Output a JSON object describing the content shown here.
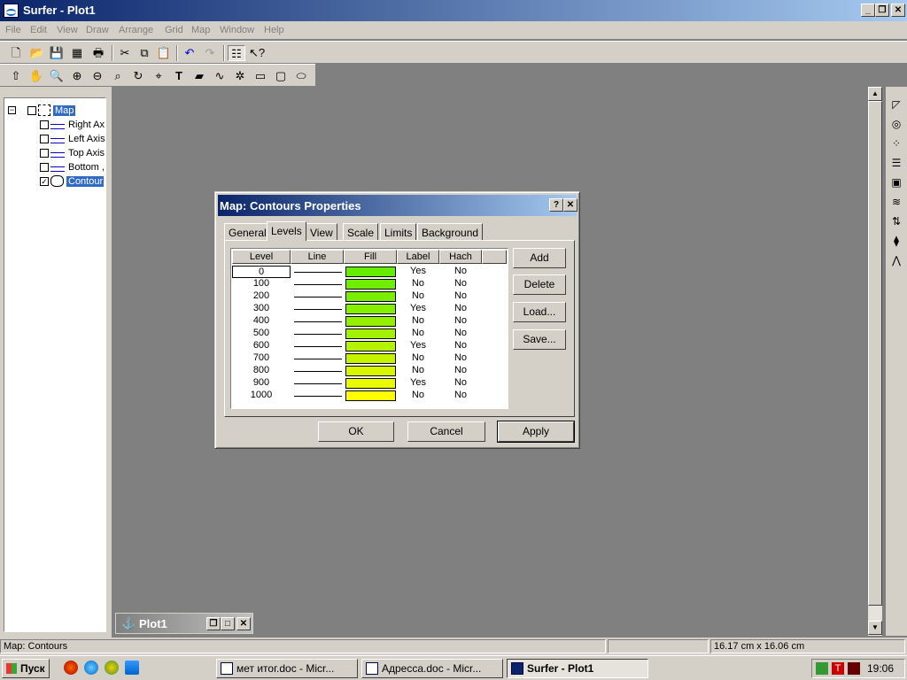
{
  "window": {
    "title": "Surfer - Plot1"
  },
  "menu": [
    "File",
    "Edit",
    "View",
    "Draw",
    "Arrange",
    "Grid",
    "Map",
    "Window",
    "Help"
  ],
  "tree": {
    "root": "Map",
    "items": [
      {
        "label": "Right Ax",
        "checked": false
      },
      {
        "label": "Left Axis",
        "checked": false
      },
      {
        "label": "Top Axis",
        "checked": false
      },
      {
        "label": "Bottom ,",
        "checked": false
      },
      {
        "label": "Contour",
        "checked": true
      }
    ]
  },
  "dialog": {
    "title": "Map: Contours Properties",
    "help": "?",
    "close": "✕",
    "tabs": [
      "General",
      "Levels",
      "View",
      "Scale",
      "Limits",
      "Background"
    ],
    "active_tab": "Levels",
    "columns": [
      "Level",
      "Line",
      "Fill",
      "Label",
      "Hach"
    ],
    "rows": [
      {
        "level": "0",
        "label": "Yes",
        "hach": "No",
        "fill": "#66ee00"
      },
      {
        "level": "100",
        "label": "No",
        "hach": "No",
        "fill": "#70ee00"
      },
      {
        "level": "200",
        "label": "No",
        "hach": "No",
        "fill": "#7aee00"
      },
      {
        "level": "300",
        "label": "Yes",
        "hach": "No",
        "fill": "#86ef00"
      },
      {
        "level": "400",
        "label": "No",
        "hach": "No",
        "fill": "#94f000"
      },
      {
        "level": "500",
        "label": "No",
        "hach": "No",
        "fill": "#a2f100"
      },
      {
        "level": "600",
        "label": "Yes",
        "hach": "No",
        "fill": "#b4f200"
      },
      {
        "level": "700",
        "label": "No",
        "hach": "No",
        "fill": "#c6f400"
      },
      {
        "level": "800",
        "label": "No",
        "hach": "No",
        "fill": "#d8f600"
      },
      {
        "level": "900",
        "label": "Yes",
        "hach": "No",
        "fill": "#eafa00"
      },
      {
        "level": "1000",
        "label": "No",
        "hach": "No",
        "fill": "#ffff00"
      }
    ],
    "side_buttons": [
      "Add",
      "Delete",
      "Load...",
      "Save..."
    ],
    "ok": "OK",
    "cancel": "Cancel",
    "apply": "Apply"
  },
  "minimized": {
    "title": "Plot1"
  },
  "status": {
    "left": "Map: Contours",
    "right": "16.17 cm x 16.06 cm"
  },
  "taskbar": {
    "start": "Пуск",
    "tasks": [
      "мет итог.doc - Micr...",
      "Адресса.doc - Micr...",
      "Surfer - Plot1"
    ],
    "clock": "19:06"
  }
}
